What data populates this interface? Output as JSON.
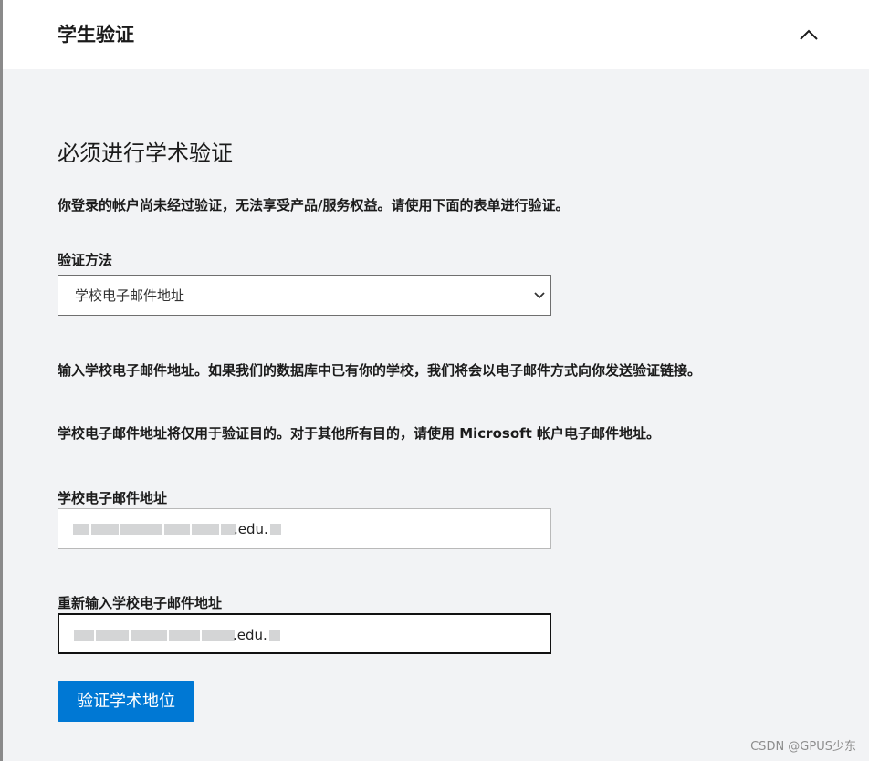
{
  "header": {
    "title": "学生验证",
    "collapse_icon": "chevron-up-icon"
  },
  "section": {
    "title": "必须进行学术验证",
    "notice": "你登录的帐户尚未经过验证，无法享受产品/服务权益。请使用下面的表单进行验证。"
  },
  "method": {
    "label": "验证方法",
    "selected": "学校电子邮件地址",
    "chevron_icon": "chevron-down-icon"
  },
  "info": {
    "line1": "输入学校电子邮件地址。如果我们的数据库中已有你的学校，我们将会以电子邮件方式向你发送验证链接。",
    "line2": "学校电子邮件地址将仅用于验证目的。对于其他所有目的，请使用 Microsoft 帐户电子邮件地址。"
  },
  "email": {
    "label": "学校电子邮件地址",
    "value_visible_suffix": ".edu."
  },
  "email_confirm": {
    "label": "重新输入学校电子邮件地址",
    "value_visible_suffix": ".edu."
  },
  "submit": {
    "label": "验证学术地位"
  },
  "watermark": "CSDN @GPUS少东",
  "colors": {
    "primary": "#0078d4",
    "background": "#f2f3f5",
    "header_bg": "#ffffff"
  }
}
